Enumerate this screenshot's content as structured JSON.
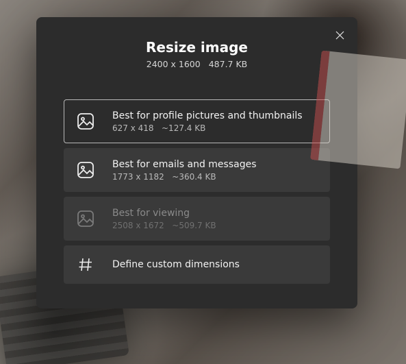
{
  "header": {
    "title": "Resize image",
    "original_dimensions": "2400 x 1600",
    "original_size": "487.7 KB"
  },
  "options": [
    {
      "label": "Best for profile pictures and thumbnails",
      "dimensions": "627 x 418",
      "size": "~127.4 KB",
      "selected": true,
      "disabled": false
    },
    {
      "label": "Best for emails and messages",
      "dimensions": "1773 x 1182",
      "size": "~360.4 KB",
      "selected": false,
      "disabled": false
    },
    {
      "label": "Best for viewing",
      "dimensions": "2508 x 1672",
      "size": "~509.7 KB",
      "selected": false,
      "disabled": true
    }
  ],
  "custom": {
    "label": "Define custom dimensions"
  },
  "icons": {
    "close": "close-icon",
    "picture": "picture-icon",
    "hash": "hash-icon"
  }
}
